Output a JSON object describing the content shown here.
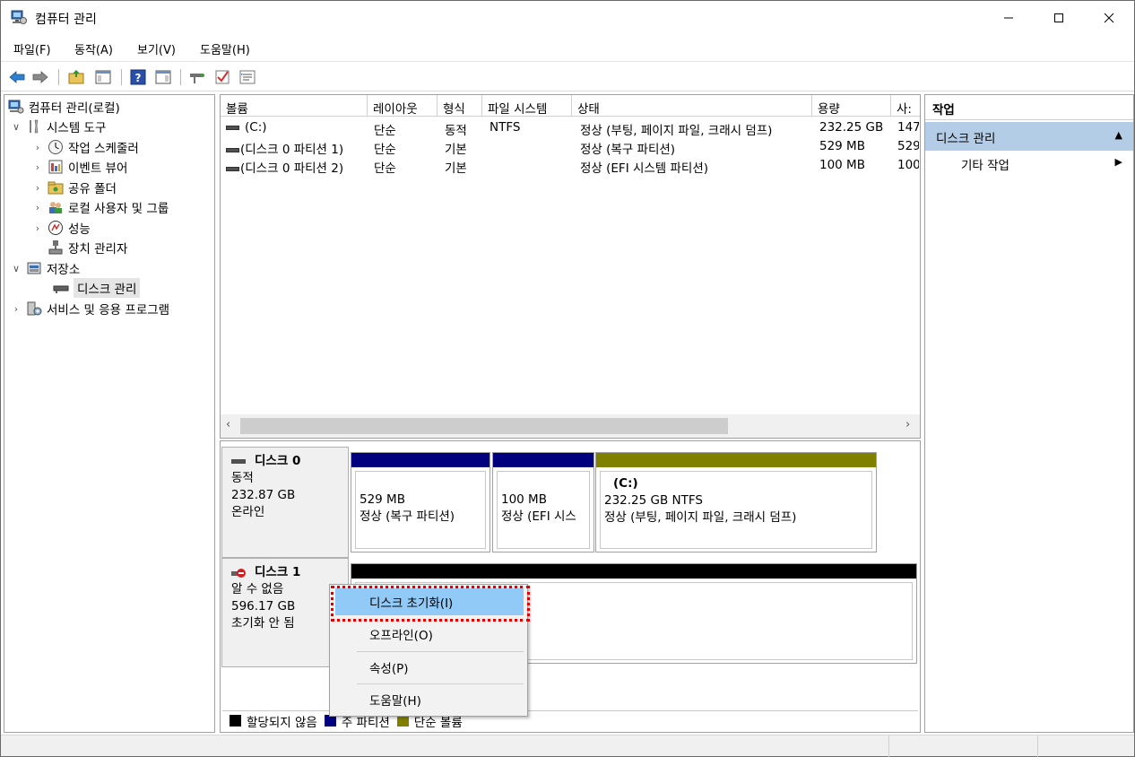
{
  "window": {
    "title": "컴퓨터 관리",
    "controls": {
      "minimize": "─",
      "maximize": "☐",
      "close": "✕"
    }
  },
  "menu": [
    "파일(F)",
    "동작(A)",
    "보기(V)",
    "도움말(H)"
  ],
  "toolbar": {
    "icons": [
      "back-arrow-icon",
      "forward-arrow-icon",
      "up-folder-icon",
      "show-hide-tree-icon",
      "help-icon",
      "show-action-pane-icon",
      "connect-icon",
      "check-icon",
      "properties-icon"
    ]
  },
  "tree": {
    "root": "컴퓨터 관리(로컬)",
    "system_tools": "시스템 도구",
    "task_scheduler": "작업 스케줄러",
    "event_viewer": "이벤트 뷰어",
    "shared_folders": "공유 폴더",
    "local_users": "로컬 사용자 및 그룹",
    "performance": "성능",
    "device_manager": "장치 관리자",
    "storage": "저장소",
    "disk_management": "디스크 관리",
    "services": "서비스 및 응용 프로그램"
  },
  "volumes": {
    "columns": [
      "볼륨",
      "레이아웃",
      "형식",
      "파일 시스템",
      "상태",
      "용량",
      "사:"
    ],
    "rows": [
      {
        "volume": "(C:)",
        "layout": "단순",
        "type": "동적",
        "fs": "NTFS",
        "status": "정상 (부팅, 페이지 파일, 크래시 덤프)",
        "capacity": "232.25 GB",
        "free": "147"
      },
      {
        "volume": "(디스크 0 파티션 1)",
        "layout": "단순",
        "type": "기본",
        "fs": "",
        "status": "정상 (복구 파티션)",
        "capacity": "529 MB",
        "free": "529"
      },
      {
        "volume": "(디스크 0 파티션 2)",
        "layout": "단순",
        "type": "기본",
        "fs": "",
        "status": "정상 (EFI 시스템 파티션)",
        "capacity": "100 MB",
        "free": "100"
      }
    ]
  },
  "disk0": {
    "name": "디스크 0",
    "type": "동적",
    "size": "232.87 GB",
    "state": "온라인",
    "partitions": [
      {
        "size": "529 MB",
        "status": "정상 (복구 파티션)",
        "color": "#00007f"
      },
      {
        "size": "100 MB",
        "status": "정상 (EFI 시스",
        "color": "#00007f"
      },
      {
        "label": "(C:)",
        "size": "232.25 GB NTFS",
        "status": "정상 (부팅, 페이지 파일, 크래시 덤프)",
        "color": "#808000"
      }
    ]
  },
  "disk1": {
    "name": "디스크 1",
    "type": "알 수 없음",
    "size": "596.17 GB",
    "state": "초기화 안 됨",
    "bar_color": "#000000"
  },
  "legend": {
    "unallocated": "할당되지 않음",
    "primary": "주 파티션",
    "simple": "단순 볼륨",
    "colors": {
      "unallocated": "#000000",
      "primary": "#00007f",
      "simple": "#808000"
    }
  },
  "context_menu": {
    "init_disk": "디스크 초기화(I)",
    "offline": "오프라인(O)",
    "properties": "속성(P)",
    "help": "도움말(H)"
  },
  "actions": {
    "header": "작업",
    "section": "디스크 관리",
    "section_arrow": "▲",
    "more": "기타 작업",
    "more_arrow": "▶"
  }
}
